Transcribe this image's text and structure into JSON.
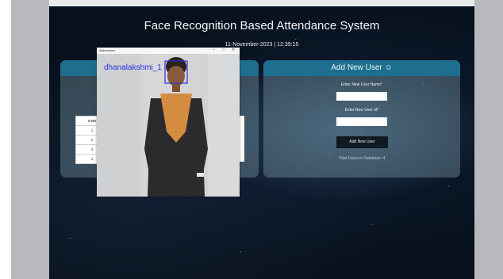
{
  "page": {
    "title": "Face Recognition Based Attendance System",
    "datetime": "11-November-2023 | 12:39:15"
  },
  "add_user": {
    "header": "Add New User",
    "name_label": "Enter New User Name*",
    "id_label": "Enter New User Id*",
    "name_value": "",
    "id_value": "",
    "button_label": "Add New User",
    "total_text": "Total Users in Database: 4"
  },
  "attendance_table": {
    "header": "S No",
    "rows": [
      "1",
      "2",
      "3",
      "4"
    ]
  },
  "camera_window": {
    "title": "Attendance",
    "min": "–",
    "max": "□",
    "close": "✕",
    "recognized_name": "dhanalakshmi_1"
  },
  "colors": {
    "header_bar": "#1e6f8f",
    "face_box": "#2b2fe0",
    "background": "#07101c"
  }
}
